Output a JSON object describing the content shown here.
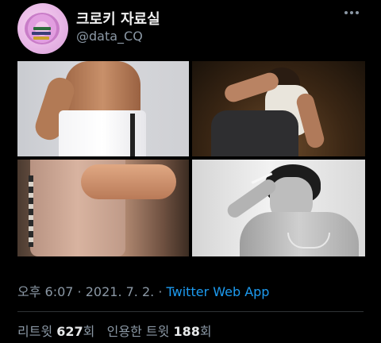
{
  "header": {
    "display_name": "크로키 자료실",
    "handle": "@data_CQ",
    "more_icon": "more-horizontal-icon"
  },
  "media": [
    {
      "name": "photo-shirtless-torso",
      "kind": "image"
    },
    {
      "name": "photo-man-sitting-tanktop",
      "kind": "image"
    },
    {
      "name": "photo-back-tanktop",
      "kind": "image"
    },
    {
      "name": "photo-man-smoking",
      "kind": "image"
    }
  ],
  "meta": {
    "time": "오후 6:07",
    "sep1": " · ",
    "date": "2021. 7. 2.",
    "sep2": " · ",
    "app": "Twitter Web App"
  },
  "stats": {
    "retweet_label": "리트윗",
    "retweet_count": "627",
    "retweet_unit": "회",
    "quote_label": "인용한 트윗",
    "quote_count": "188",
    "quote_unit": "회"
  },
  "colors": {
    "background": "#000000",
    "link": "#1d9bf0",
    "secondary_text": "#8b98a5"
  }
}
